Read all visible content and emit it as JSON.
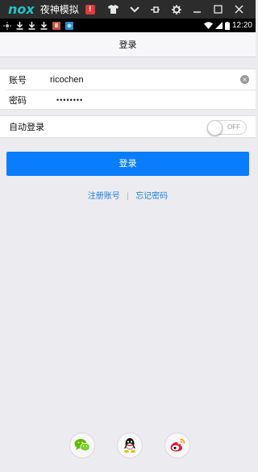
{
  "emulator": {
    "logo": "nox",
    "title": "夜神模拟",
    "alert_badge": "!"
  },
  "status_bar": {
    "time": "12:20"
  },
  "nav": {
    "title": "登录"
  },
  "form": {
    "account_label": "账号",
    "account_value": "ricochen",
    "password_label": "密码",
    "password_value": "••••••••"
  },
  "auto_login": {
    "label": "自动登录",
    "toggle_text": "OFF",
    "enabled": false
  },
  "login_button": "登录",
  "links": {
    "register": "注册账号",
    "separator": "|",
    "forgot": "忘记密码"
  },
  "social": {
    "icons": [
      "wechat-icon",
      "qq-icon",
      "weibo-icon"
    ]
  },
  "colors": {
    "accent": "#0a7dfd",
    "link": "#1d7fe0",
    "background": "#ececf0",
    "emulator_bar": "#2c2c2c",
    "logo": "#27c2c4"
  }
}
